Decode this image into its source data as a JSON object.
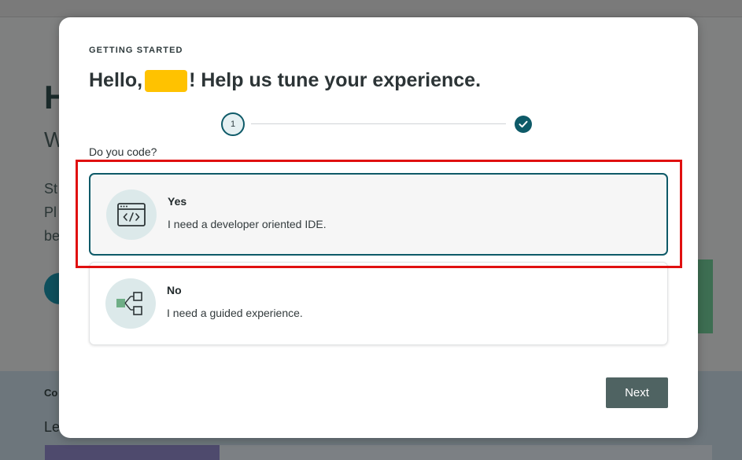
{
  "background": {
    "heading_fragment": "H",
    "sub_fragment": "W",
    "lines": [
      "St",
      "Pl",
      "be"
    ],
    "band_label_fragment": "Co",
    "band_text_fragment": "Le"
  },
  "modal": {
    "eyebrow": "GETTING STARTED",
    "title_prefix": "Hello,",
    "title_suffix": "! Help us tune your experience.",
    "stepper": {
      "current_step": "1"
    },
    "question": "Do you code?",
    "options": [
      {
        "title": "Yes",
        "description": "I need a developer oriented IDE.",
        "icon": "code-window-icon",
        "selected": true
      },
      {
        "title": "No",
        "description": "I need a guided experience.",
        "icon": "flow-diagram-icon",
        "selected": false
      }
    ],
    "next_label": "Next"
  },
  "colors": {
    "accent": "#0e5a68",
    "highlight": "#e01010",
    "redaction": "#ffc200",
    "button": "#4f6362"
  }
}
